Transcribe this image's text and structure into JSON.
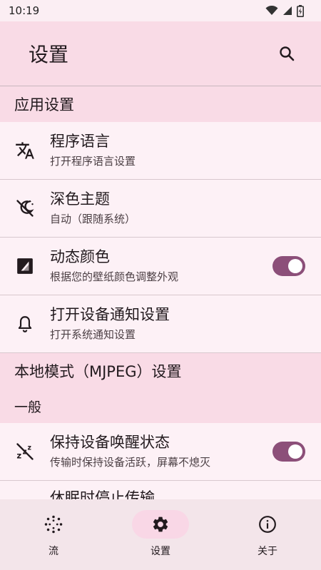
{
  "status": {
    "time": "10:19"
  },
  "app_bar": {
    "title": "设置"
  },
  "sections": {
    "app": {
      "header": "应用设置",
      "items": [
        {
          "title": "程序语言",
          "subtitle": "打开程序语言设置",
          "icon": "translate-icon"
        },
        {
          "title": "深色主题",
          "subtitle": "自动（跟随系统）",
          "icon": "dark-mode-icon"
        },
        {
          "title": "动态颜色",
          "subtitle": "根据您的壁纸颜色调整外观",
          "icon": "dynamic-color-icon",
          "toggle": true
        },
        {
          "title": "打开设备通知设置",
          "subtitle": "打开系统通知设置",
          "icon": "bell-icon"
        }
      ]
    },
    "local": {
      "header": "本地模式（MJPEG）设置",
      "subheader": "一般",
      "items": [
        {
          "title": "保持设备唤醒状态",
          "subtitle": "传输时保持设备活跃，屏幕不熄灭",
          "icon": "sleep-off-icon",
          "toggle": true
        },
        {
          "title": "休眠时停止传输"
        }
      ]
    }
  },
  "nav": {
    "items": [
      {
        "label": "流",
        "icon": "stream-icon"
      },
      {
        "label": "设置",
        "icon": "gear-icon",
        "active": true
      },
      {
        "label": "关于",
        "icon": "info-icon"
      }
    ]
  },
  "colors": {
    "accent": "#8c4f79",
    "header_bg": "#f9dbe6",
    "item_bg": "#fdf1f6"
  }
}
